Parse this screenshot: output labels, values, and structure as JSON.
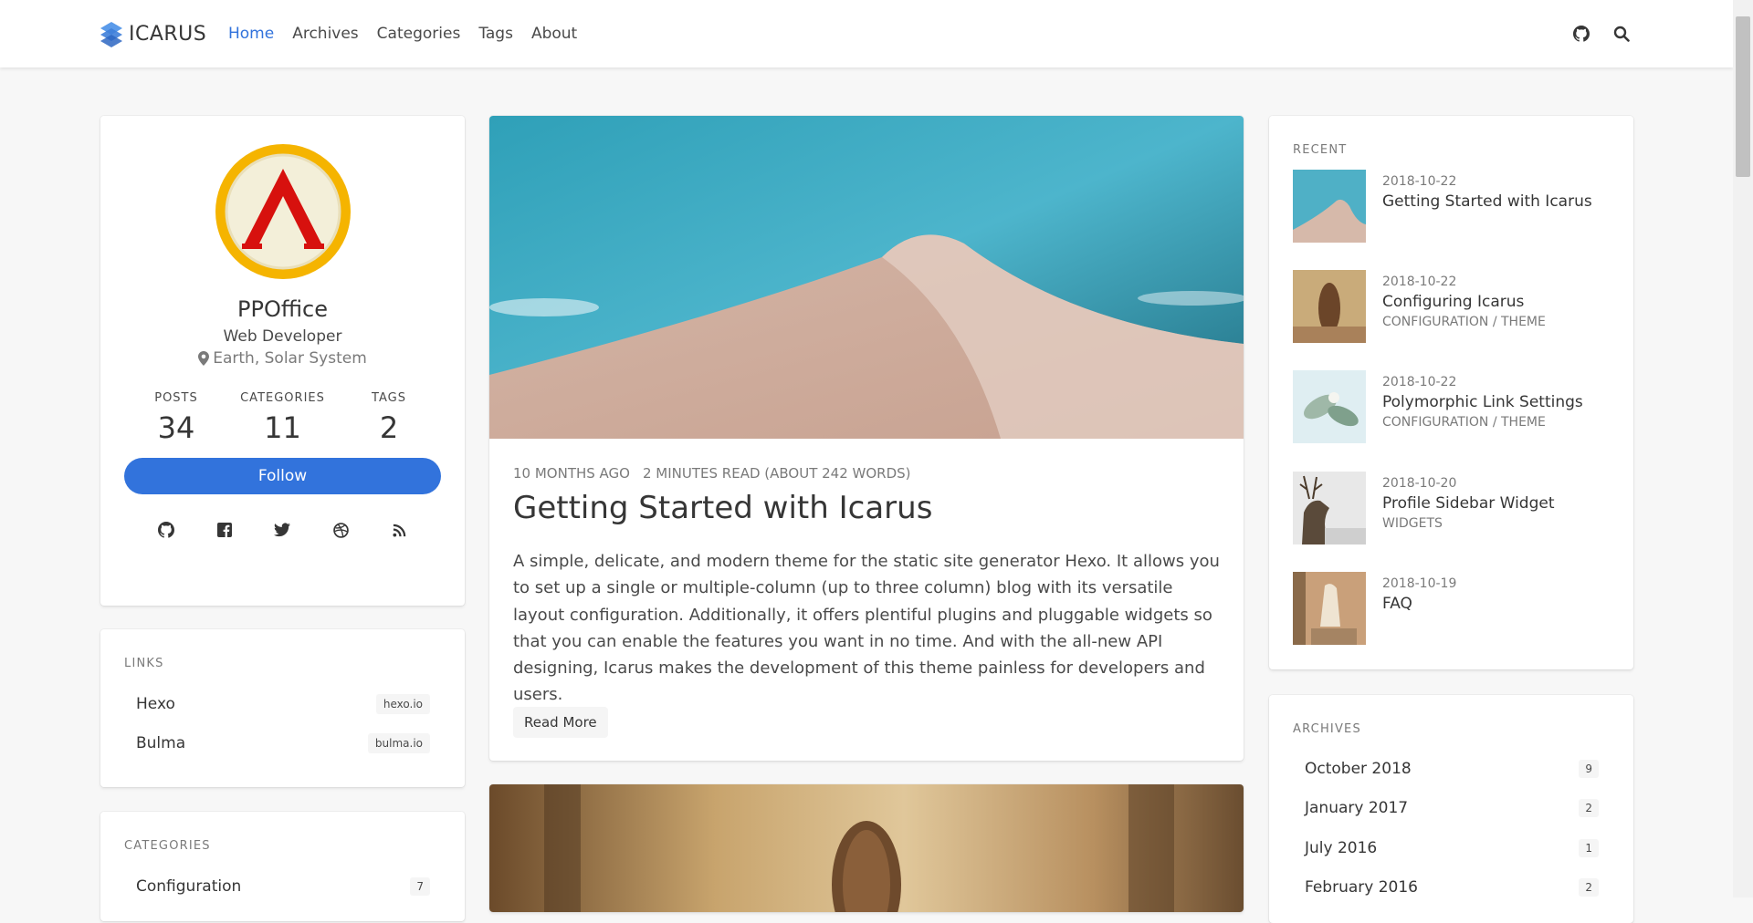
{
  "brand": {
    "name": "ICARUS"
  },
  "nav": {
    "items": [
      {
        "label": "Home",
        "active": true
      },
      {
        "label": "Archives"
      },
      {
        "label": "Categories"
      },
      {
        "label": "Tags"
      },
      {
        "label": "About"
      }
    ],
    "icons": [
      "github-icon",
      "search-icon"
    ]
  },
  "profile": {
    "name": "PPOffice",
    "title": "Web Developer",
    "location": "Earth, Solar System",
    "stats": [
      {
        "label": "POSTS",
        "value": "34"
      },
      {
        "label": "CATEGORIES",
        "value": "11"
      },
      {
        "label": "TAGS",
        "value": "2"
      }
    ],
    "follow_label": "Follow",
    "socials": [
      "github-icon",
      "facebook-icon",
      "twitter-icon",
      "dribbble-icon",
      "rss-icon"
    ]
  },
  "links": {
    "heading": "LINKS",
    "items": [
      {
        "name": "Hexo",
        "url": "hexo.io"
      },
      {
        "name": "Bulma",
        "url": "bulma.io"
      }
    ]
  },
  "categories": {
    "heading": "CATEGORIES",
    "items": [
      {
        "name": "Configuration",
        "count": "7"
      }
    ]
  },
  "post": {
    "time": "10 MONTHS AGO",
    "read": "2 MINUTES READ (ABOUT 242 WORDS)",
    "title": "Getting Started with Icarus",
    "body": "A simple, delicate, and modern theme for the static site generator Hexo. It allows you to set up a single or multiple-column (up to three column) blog with its versatile layout configuration. Additionally, it offers plentiful plugins and pluggable widgets so that you can enable the features you want in no time. And with the all-new API designing, Icarus makes the development of this theme painless for developers and users.",
    "read_more": "Read More"
  },
  "recent": {
    "heading": "RECENT",
    "items": [
      {
        "date": "2018-10-22",
        "title": "Getting Started with Icarus",
        "cat1": "",
        "cat2": "",
        "sep": ""
      },
      {
        "date": "2018-10-22",
        "title": "Configuring Icarus",
        "cat1": "CONFIGURATION",
        "cat2": "THEME",
        "sep": " / "
      },
      {
        "date": "2018-10-22",
        "title": "Polymorphic Link Settings",
        "cat1": "CONFIGURATION",
        "cat2": "THEME",
        "sep": " / "
      },
      {
        "date": "2018-10-20",
        "title": "Profile Sidebar Widget",
        "cat1": "WIDGETS",
        "cat2": "",
        "sep": ""
      },
      {
        "date": "2018-10-19",
        "title": "FAQ",
        "cat1": "",
        "cat2": "",
        "sep": ""
      }
    ]
  },
  "archives": {
    "heading": "ARCHIVES",
    "items": [
      {
        "name": "October 2018",
        "count": "9"
      },
      {
        "name": "January 2017",
        "count": "2"
      },
      {
        "name": "July 2016",
        "count": "1"
      },
      {
        "name": "February 2016",
        "count": "2"
      }
    ]
  },
  "colors": {
    "accent": "#3273dc",
    "text": "#4a4a4a",
    "heading": "#363636",
    "muted": "#7a7a7a",
    "bg": "#f7f7f7"
  }
}
